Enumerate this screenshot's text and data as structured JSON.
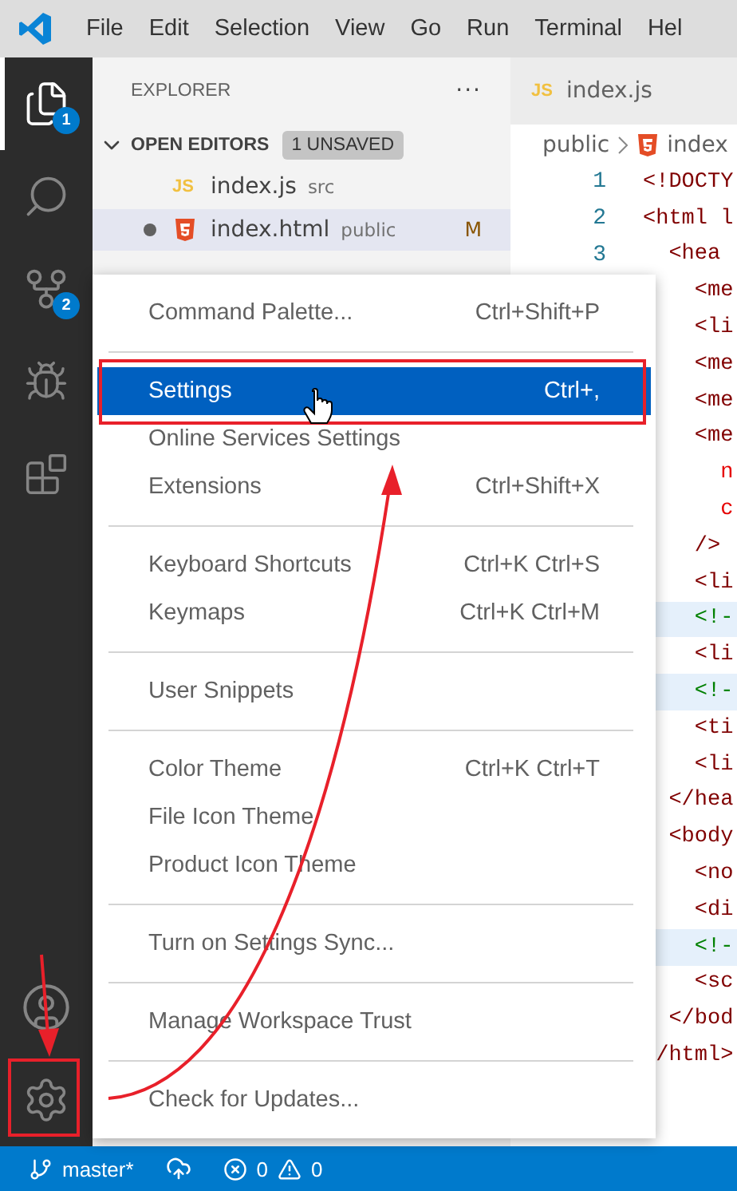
{
  "menu_bar": [
    "File",
    "Edit",
    "Selection",
    "View",
    "Go",
    "Run",
    "Terminal",
    "Hel"
  ],
  "activity_bar": {
    "top": [
      {
        "kind": "files",
        "selected": true,
        "badge": "1"
      },
      {
        "kind": "search",
        "selected": false
      },
      {
        "kind": "source-control",
        "selected": false,
        "badge": "2"
      },
      {
        "kind": "run",
        "selected": false
      },
      {
        "kind": "extensions",
        "selected": false
      }
    ],
    "bottom": [
      {
        "kind": "account",
        "selected": false
      },
      {
        "kind": "manage",
        "selected": false
      }
    ]
  },
  "sidebar": {
    "title": "EXPLORER",
    "more": "···",
    "section": {
      "title": "OPEN EDITORS",
      "expanded": true,
      "badge": "1 UNSAVED",
      "files": [
        {
          "name": "index.js",
          "folder": "src",
          "kind": "js",
          "icon_label": "JS",
          "unsaved": false,
          "selected": false
        },
        {
          "name": "index.html",
          "folder": "public",
          "kind": "html",
          "unsaved": true,
          "selected": true,
          "status": "M"
        }
      ]
    }
  },
  "editor": {
    "tab": {
      "name": "index.js",
      "kind": "js",
      "icon_label": "JS"
    },
    "breadcrumb": [
      {
        "text": "public"
      },
      {
        "text": "index",
        "kind": "html"
      }
    ],
    "lines": [
      {
        "number": "1",
        "text": "<!DOCTY",
        "kind": "tag",
        "highlighted": false
      },
      {
        "number": "2",
        "text": "<html l",
        "kind": "tag",
        "highlighted": false
      },
      {
        "number": "3",
        "text": "  <hea",
        "kind": "tag",
        "highlighted": false
      },
      {
        "text": "    <me",
        "kind": "tag",
        "highlighted": false
      },
      {
        "text": "    <li",
        "kind": "tag",
        "highlighted": false
      },
      {
        "text": "    <me",
        "kind": "tag",
        "highlighted": false
      },
      {
        "text": "    <me",
        "kind": "tag",
        "highlighted": false
      },
      {
        "text": "    <me",
        "kind": "tag",
        "highlighted": false
      },
      {
        "text": "      n",
        "kind": "attr",
        "highlighted": false
      },
      {
        "text": "      c",
        "kind": "attr",
        "highlighted": false
      },
      {
        "text": "    />",
        "kind": "tag",
        "highlighted": false
      },
      {
        "text": "    <li",
        "kind": "tag",
        "highlighted": false
      },
      {
        "text": "    <!-",
        "kind": "comment",
        "highlighted": true
      },
      {
        "text": "    <li",
        "kind": "tag",
        "highlighted": false
      },
      {
        "text": "    <!-",
        "kind": "comment",
        "highlighted": true
      },
      {
        "text": "    <ti",
        "kind": "tag",
        "highlighted": false
      },
      {
        "text": "    <li",
        "kind": "tag",
        "highlighted": false
      },
      {
        "text": "  </hea",
        "kind": "tag",
        "highlighted": false
      },
      {
        "text": "  <body",
        "kind": "tag",
        "highlighted": false
      },
      {
        "text": "    <no",
        "kind": "tag",
        "highlighted": false
      },
      {
        "text": "    <di",
        "kind": "tag",
        "highlighted": false
      },
      {
        "text": "    <!-",
        "kind": "comment",
        "highlighted": true
      },
      {
        "text": "    <sc",
        "kind": "tag",
        "highlighted": false
      },
      {
        "text": "  </bod",
        "kind": "tag",
        "highlighted": false
      },
      {
        "text": " /html>",
        "kind": "tag",
        "highlighted": false
      }
    ]
  },
  "context_menu": {
    "groups": [
      [
        {
          "label": "Command Palette...",
          "shortcut": "Ctrl+Shift+P",
          "selected": false
        }
      ],
      [
        {
          "label": "Settings",
          "shortcut": "Ctrl+,",
          "selected": true
        },
        {
          "label": "Online Services Settings",
          "selected": false
        },
        {
          "label": "Extensions",
          "shortcut": "Ctrl+Shift+X",
          "selected": false
        }
      ],
      [
        {
          "label": "Keyboard Shortcuts",
          "shortcut": "Ctrl+K Ctrl+S",
          "selected": false
        },
        {
          "label": "Keymaps",
          "shortcut": "Ctrl+K Ctrl+M",
          "selected": false
        }
      ],
      [
        {
          "label": "User Snippets",
          "selected": false
        }
      ],
      [
        {
          "label": "Color Theme",
          "shortcut": "Ctrl+K Ctrl+T",
          "selected": false
        },
        {
          "label": "File Icon Theme",
          "selected": false
        },
        {
          "label": "Product Icon Theme",
          "selected": false
        }
      ],
      [
        {
          "label": "Turn on Settings Sync...",
          "selected": false
        }
      ],
      [
        {
          "label": "Manage Workspace Trust",
          "selected": false
        }
      ],
      [
        {
          "label": "Check for Updates...",
          "selected": false
        }
      ]
    ]
  },
  "status_bar": {
    "branch": "master*",
    "errors": "0",
    "warnings": "0"
  }
}
